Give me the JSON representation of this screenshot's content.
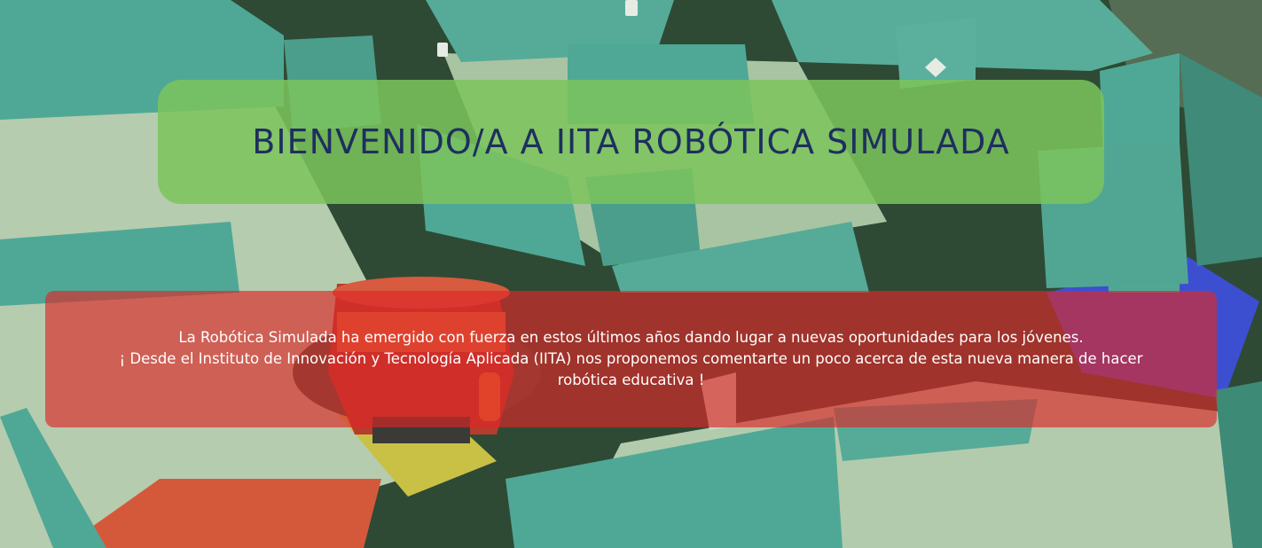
{
  "hero": {
    "title": "BIENVENIDO/A A IITA ROBÓTICA SIMULADA",
    "intro_line1": "La Robótica Simulada ha emergido con fuerza en estos últimos años dando lugar a nuevas oportunidades para los jóvenes.",
    "intro_line2": "¡ Desde el Instituto de Innovación y Tecnología Aplicada (IITA) nos proponemos comentarte un poco acerca de esta nueva manera de hacer robótica educativa !"
  },
  "colors": {
    "title_panel": "#7cc45c",
    "title_text": "#1e2f5e",
    "intro_panel": "#dc2828",
    "intro_text": "#ffffff",
    "maze_wall": "#4fa896",
    "maze_floor": "#b7cfb0",
    "maze_shadow": "#2d4a34"
  },
  "background": {
    "scene": "simulated-robot-maze",
    "icons": [
      "robot-icon",
      "maze-icon"
    ]
  }
}
